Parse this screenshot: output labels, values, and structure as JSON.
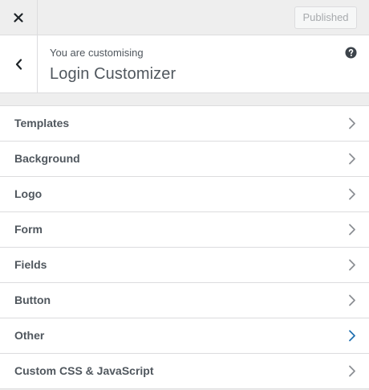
{
  "topbar": {
    "close_icon": "close-icon",
    "publish_label": "Published"
  },
  "header": {
    "back_icon": "chevron-left-icon",
    "customising_label": "You are customising",
    "title": "Login Customizer",
    "help_icon": "help-icon"
  },
  "sections": {
    "items": [
      {
        "label": "Templates",
        "active": false
      },
      {
        "label": "Background",
        "active": false
      },
      {
        "label": "Logo",
        "active": false
      },
      {
        "label": "Form",
        "active": false
      },
      {
        "label": "Fields",
        "active": false
      },
      {
        "label": "Button",
        "active": false
      },
      {
        "label": "Other",
        "active": true
      },
      {
        "label": "Custom CSS & JavaScript",
        "active": false
      }
    ]
  },
  "colors": {
    "accent": "#2271b1",
    "text": "#50575e",
    "border": "#dcdcde",
    "background": "#eeeeee"
  }
}
